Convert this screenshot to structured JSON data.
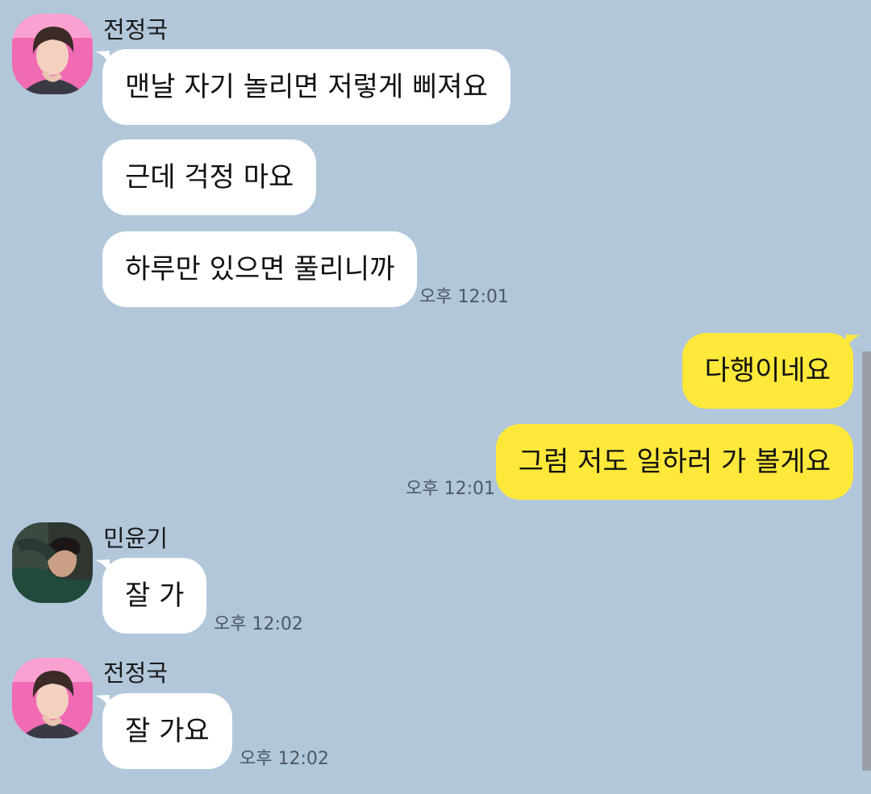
{
  "colors": {
    "background": "#b2c7da",
    "incoming_bubble": "#ffffff",
    "outgoing_bubble": "#fee83a",
    "time_text": "#4d5966"
  },
  "groups": [
    {
      "sender": "전정국",
      "avatar": "profile-photo-pink-background",
      "messages": [
        "맨날 자기 놀리면 저렇게 삐져요",
        "근데 걱정 마요",
        "하루만 있으면 풀리니까"
      ],
      "time": "오후 12:01"
    },
    {
      "sender": "me",
      "messages": [
        "다행이네요",
        "그럼 저도 일하러 가 볼게요"
      ],
      "time": "오후 12:01"
    },
    {
      "sender": "민윤기",
      "avatar": "profile-photo-dark-green-sweater",
      "messages": [
        "잘 가"
      ],
      "time": "오후 12:02"
    },
    {
      "sender": "전정국",
      "avatar": "profile-photo-pink-background",
      "messages": [
        "잘 가요"
      ],
      "time": "오후 12:02"
    }
  ]
}
